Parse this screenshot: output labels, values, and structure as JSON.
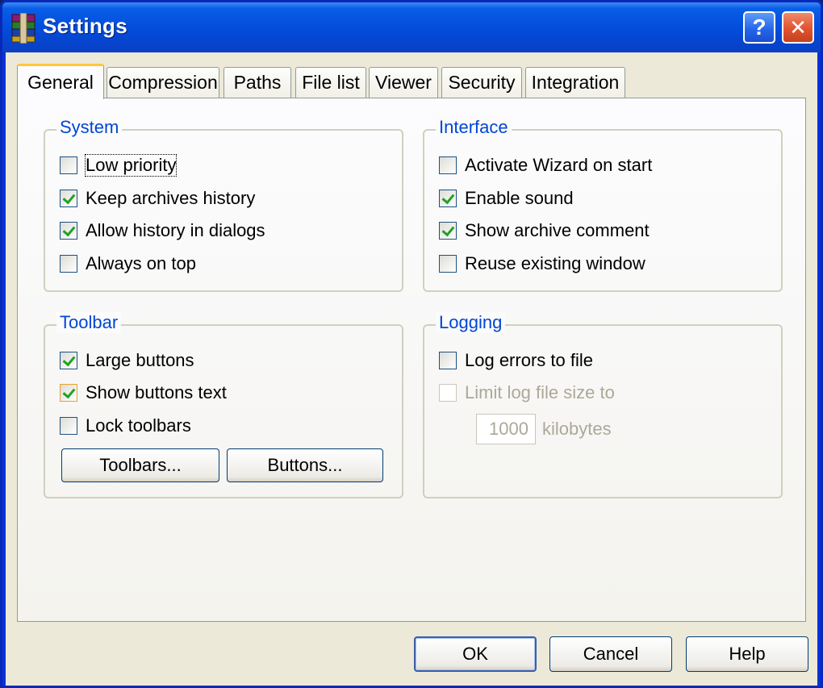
{
  "window": {
    "title": "Settings",
    "help_glyph": "?",
    "close_glyph": "✕"
  },
  "tabs": [
    "General",
    "Compression",
    "Paths",
    "File list",
    "Viewer",
    "Security",
    "Integration"
  ],
  "active_tab": "General",
  "groups": {
    "system": {
      "title": "System",
      "items": [
        {
          "label": "Low priority",
          "checked": false
        },
        {
          "label": "Keep archives history",
          "checked": true
        },
        {
          "label": "Allow history in dialogs",
          "checked": true
        },
        {
          "label": "Always on top",
          "checked": false
        }
      ]
    },
    "interface": {
      "title": "Interface",
      "items": [
        {
          "label": "Activate Wizard on start",
          "checked": false
        },
        {
          "label": "Enable sound",
          "checked": true
        },
        {
          "label": "Show archive comment",
          "checked": true
        },
        {
          "label": "Reuse existing window",
          "checked": false
        }
      ]
    },
    "toolbar": {
      "title": "Toolbar",
      "items": [
        {
          "label": "Large buttons",
          "checked": true
        },
        {
          "label": "Show buttons text",
          "checked": true
        },
        {
          "label": "Lock toolbars",
          "checked": false
        }
      ],
      "toolbars_button": "Toolbars...",
      "buttons_button": "Buttons..."
    },
    "logging": {
      "title": "Logging",
      "items": [
        {
          "label": "Log errors to file",
          "checked": false
        },
        {
          "label": "Limit log file size to",
          "checked": false,
          "disabled": true
        }
      ],
      "size_value": "1000",
      "size_unit": "kilobytes"
    }
  },
  "footer": {
    "ok": "OK",
    "cancel": "Cancel",
    "help": "Help"
  },
  "colors": {
    "titlebar": "#0551e0",
    "group_title": "#0046d5",
    "check": "#21a121",
    "tab_highlight": "#ffc83c"
  }
}
